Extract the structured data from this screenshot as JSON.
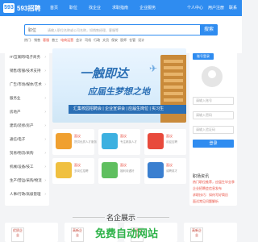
{
  "header": {
    "logo_mark": "593",
    "logo_text": "593招聘",
    "nav": [
      "首页",
      "职位",
      "找企业",
      "求职指南",
      "企业服务"
    ],
    "right": [
      "个人中心",
      "用户注册",
      "联系"
    ]
  },
  "search": {
    "city": "职位",
    "placeholder": "请输入职位名称或公司名称，如销售经理、客服等",
    "button": "搜索",
    "hot": [
      {
        "t": "热门:",
        "c": "n"
      },
      {
        "t": "销售",
        "c": "n"
      },
      {
        "t": "客服",
        "c": "r"
      },
      {
        "t": "普工",
        "c": "n"
      },
      {
        "t": "电商运营",
        "c": "r"
      },
      {
        "t": "会计",
        "c": "n"
      },
      {
        "t": "司机",
        "c": "n"
      },
      {
        "t": "行政",
        "c": "n"
      },
      {
        "t": "文员",
        "c": "n"
      },
      {
        "t": "保安",
        "c": "n"
      },
      {
        "t": "厨师",
        "c": "n"
      },
      {
        "t": "仓管",
        "c": "n"
      },
      {
        "t": "设计",
        "c": "n"
      }
    ]
  },
  "sidebar": {
    "items": [
      "IT/互联网/电子商务",
      "销售/客服/技术支持",
      "广告/市场/媒体/艺术",
      "服务业",
      "房地产",
      "建筑/装修/房产",
      "通信/电子",
      "贸易/物流/采购",
      "机械/设备/技工",
      "生产/营运/采购/物流",
      "人事/行政/高级管理"
    ]
  },
  "banner": {
    "line1": "一触即达",
    "line2": "应届生梦想之地",
    "ribbon": "汇集校园招聘会 | 企业宣讲会 | 应届生岗位 | 实习生"
  },
  "cards": [
    {
      "val": "面议",
      "sub": "提供优质人才服务"
    },
    {
      "val": "面议",
      "sub": "专注精英人才"
    },
    {
      "val": "面议",
      "sub": "欢迎应聘"
    },
    {
      "val": "面议",
      "sub": "多岗位招聘"
    },
    {
      "val": "面议",
      "sub": "福利待遇好"
    },
    {
      "val": "面议",
      "sub": "诚聘英才"
    }
  ],
  "card_colors": [
    "#f0a030",
    "#3cb0e0",
    "#e84a3c",
    "#f0c040",
    "#5fbf5f",
    "#3a7fd0"
  ],
  "login": {
    "tab": "账号登录",
    "fields": [
      "请输入账号",
      "请输入密码",
      "请输入验证码"
    ],
    "button": "登录",
    "news_title": "职场资讯",
    "news": [
      "热门职位推荐，应届生毕业季",
      "企业招聘会信息发布",
      "求职技巧：如何写好简历",
      "面试常见问题解析"
    ]
  },
  "section": {
    "title": "名企展示"
  },
  "bottom": [
    {
      "logo": "优质企业",
      "name": "名企"
    },
    {
      "logo": "高新企业",
      "name": "名企"
    },
    {
      "logo": "优质企业",
      "name": "名企"
    },
    {
      "logo": "高新企业",
      "name": "名企"
    }
  ],
  "watermark": "免费自动网站"
}
